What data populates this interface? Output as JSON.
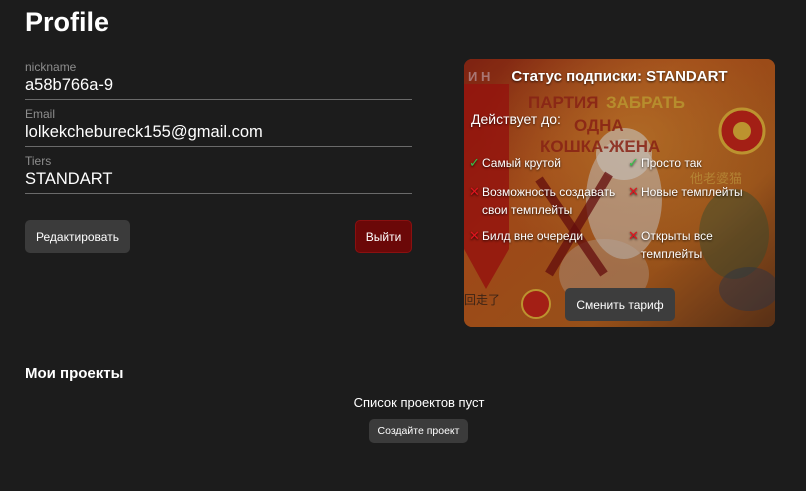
{
  "page": {
    "title": "Profile"
  },
  "profile": {
    "nickname_label": "nickname",
    "nickname_value": "a58b766a-9",
    "email_label": "Email",
    "email_value": "lolkekchebureck155@gmail.com",
    "tiers_label": "Tiers",
    "tiers_value": "STANDART",
    "edit_button": "Редактировать",
    "logout_button": "Выйти"
  },
  "subscription": {
    "title": "Статус подписки: STANDART",
    "valid_until": "Действует до:",
    "features": [
      {
        "label": "Самый крутой",
        "status": "check"
      },
      {
        "label": "Просто так",
        "status": "check"
      },
      {
        "label": "Возможность создавать свои темплейты",
        "status": "cross"
      },
      {
        "label": "Новые темплейты",
        "status": "cross"
      },
      {
        "label": "Билд вне очереди",
        "status": "cross"
      },
      {
        "label": "Открыты все темплейты",
        "status": "cross"
      }
    ],
    "change_button": "Сменить тариф",
    "background_texts": [
      "ПАРТИЯ ЗАБРАТЬ",
      "ОДНА",
      "КОШКА-ЖЕНА",
      "И Н",
      "他老婆猫",
      "回走了"
    ]
  },
  "projects": {
    "title": "Мои проекты",
    "empty_text": "Список проектов пуст",
    "create_button": "Создайте проект"
  },
  "colors": {
    "background": "#1c1c1c",
    "check": "#35c24a",
    "cross": "#e0141e",
    "logout": "#6b0808"
  }
}
